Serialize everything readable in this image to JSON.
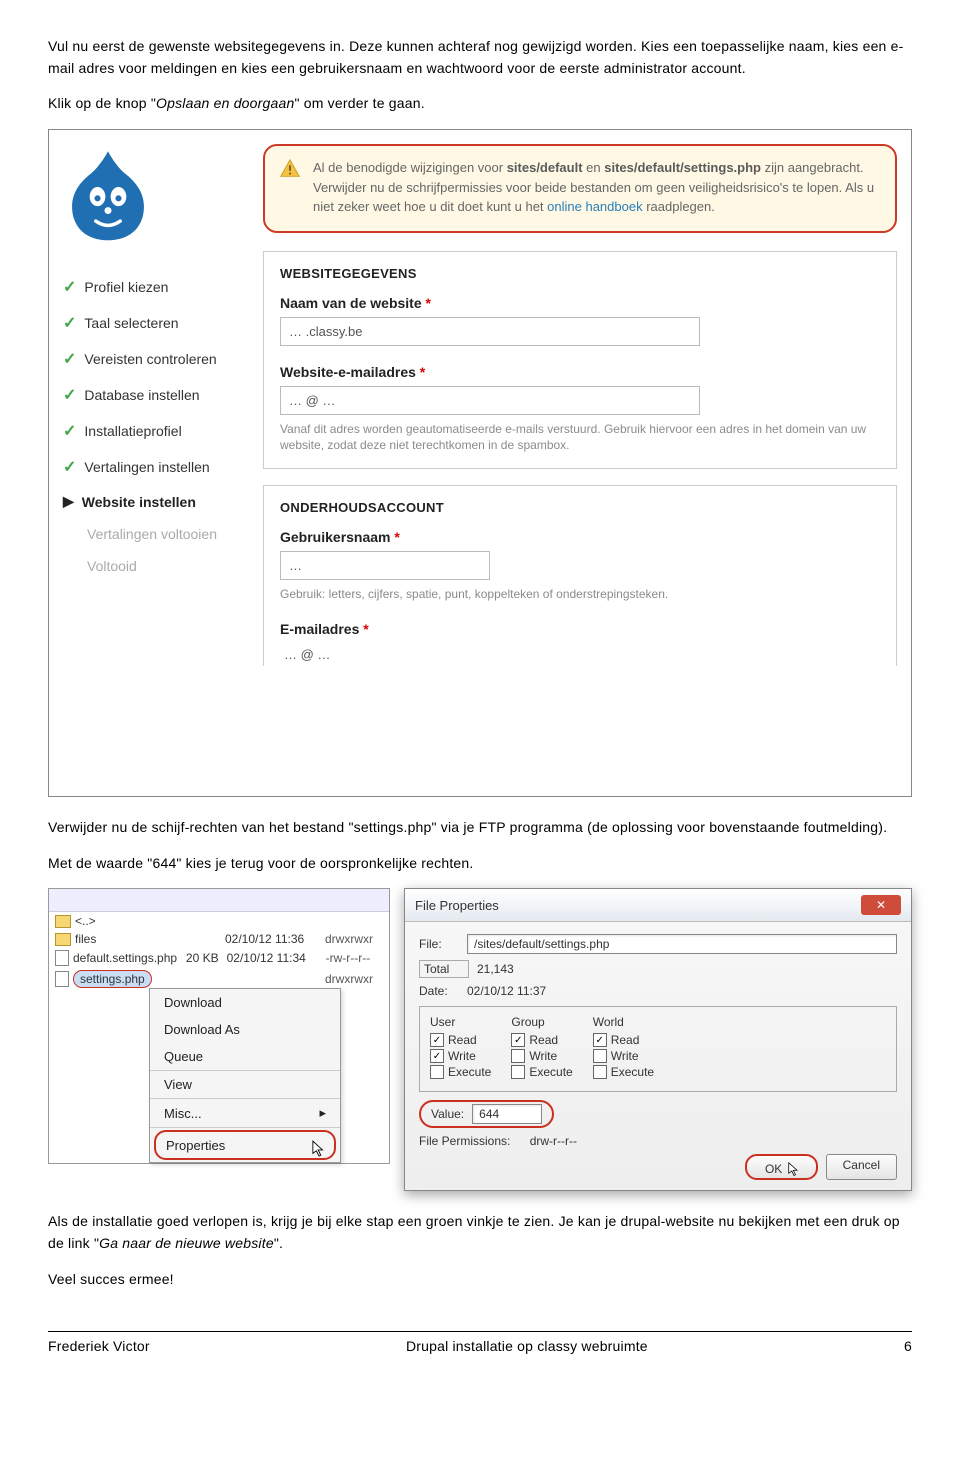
{
  "para1": "Vul nu eerst de gewenste websitegegevens in. Deze kunnen achteraf nog gewijzigd worden. Kies een toepasselijke naam, kies een e-mail adres voor meldingen en kies een gebruikersnaam en wachtwoord voor de eerste administrator account.",
  "para2a": "Klik op de knop \"",
  "para2b": "Opslaan en doorgaan",
  "para2c": "\" om verder te gaan.",
  "warning": {
    "t1": "Al de benodigde wijzigingen voor ",
    "f1": "sites/default",
    "t2": " en ",
    "f2": "sites/default/settings.php",
    "t3": " zijn aangebracht. Verwijder nu de schrijfpermissies voor beide bestanden om geen veiligheidsrisico's te lopen. Als u niet zeker weet hoe u dit doet kunt u het ",
    "link": "online handboek",
    "t4": " raadplegen."
  },
  "steps": {
    "s1": "Profiel kiezen",
    "s2": "Taal selecteren",
    "s3": "Vereisten controleren",
    "s4": "Database instellen",
    "s5": "Installatieprofiel",
    "s6": "Vertalingen instellen",
    "s7": "Website instellen",
    "s8": "Vertalingen voltooien",
    "s9": "Voltooid"
  },
  "panel1": {
    "title": "WEBSITEGEGEVENS",
    "nameLabel": "Naam van de website",
    "nameValue": "…  .classy.be",
    "emailLabel": "Website-e-mailadres",
    "emailValue": "… @ …",
    "hint": "Vanaf dit adres worden geautomatiseerde e-mails verstuurd. Gebruik hiervoor een adres in het domein van uw website, zodat deze niet terechtkomen in de spambox."
  },
  "panel2": {
    "title": "ONDERHOUDSACCOUNT",
    "userLabel": "Gebruikersnaam",
    "userValue": "…",
    "userHint": "Gebruik: letters, cijfers, spatie, punt, koppelteken of onderstrepingsteken.",
    "emailLabel": "E-mailadres",
    "emailValue": "… @ …"
  },
  "para3": "Verwijder nu de schijf-rechten van het bestand \"settings.php\" via je FTP programma (de oplossing voor bovenstaande foutmelding).",
  "para4": "Met de waarde \"644\" kies je terug voor de oorspronkelijke rechten.",
  "ftp": {
    "up": "<..>",
    "folder": "files",
    "f1": "default.settings.php",
    "f1sz": "20 KB",
    "f1dt": "02/10/12 11:34",
    "f1pm": "-rw-r--r--",
    "d1": "02/10/12 11:36",
    "d1pm": "drwxrwxr",
    "f2": "settings.php",
    "f2pm": "drwxrwxr"
  },
  "menu": {
    "m1": "Download",
    "m2": "Download As",
    "m3": "Queue",
    "m4": "View",
    "m5": "Misc...",
    "m6": "Properties"
  },
  "dlg": {
    "title": "File Properties",
    "fileLbl": "File:",
    "fileVal": "/sites/default/settings.php",
    "totalLbl": "Total",
    "totalVal": "21,143",
    "dateLbl": "Date:",
    "dateVal": "02/10/12 11:37",
    "user": "User",
    "group": "Group",
    "world": "World",
    "read": "Read",
    "write": "Write",
    "exec": "Execute",
    "valueLbl": "Value:",
    "valueVal": "644",
    "permLbl": "File Permissions:",
    "permVal": "drw-r--r--",
    "ok": "OK",
    "cancel": "Cancel"
  },
  "para5a": "Als de installatie goed verlopen is, krijg je bij elke stap een groen vinkje te zien. Je kan je drupal-website nu bekijken met een druk op de link \"",
  "para5b": "Ga naar de nieuwe website",
  "para5c": "\".",
  "para6": "Veel succes ermee!",
  "footer": {
    "left": "Frederiek Victor",
    "center": "Drupal installatie op classy webruimte",
    "right": "6"
  }
}
